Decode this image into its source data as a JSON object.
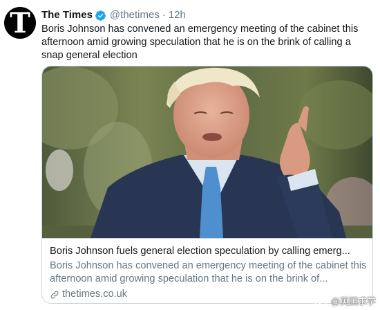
{
  "account": {
    "display_name": "The Times",
    "handle": "@thetimes",
    "separator": "·",
    "time": "12h",
    "avatar_letter": "T",
    "verified": true
  },
  "tweet": {
    "text": "Boris Johnson has convened an emergency meeting of the cabinet this afternoon amid growing speculation that he is on the brink of calling a snap general election"
  },
  "card": {
    "image_icon": "photo-of-boris-johnson",
    "title": "Boris Johnson fuels general election speculation by calling emerg...",
    "description": "Boris Johnson has convened an emergency meeting of the cabinet this afternoon amid growing speculation that he is on the brink of...",
    "domain": "thetimes.co.uk",
    "link_icon": "link-icon"
  },
  "watermark": {
    "text": "@英国求学",
    "icon": "weibo-icon"
  },
  "colors": {
    "text": "#14171a",
    "secondary": "#657786",
    "border": "#ccd6dd",
    "verified": "#1da1f2"
  }
}
